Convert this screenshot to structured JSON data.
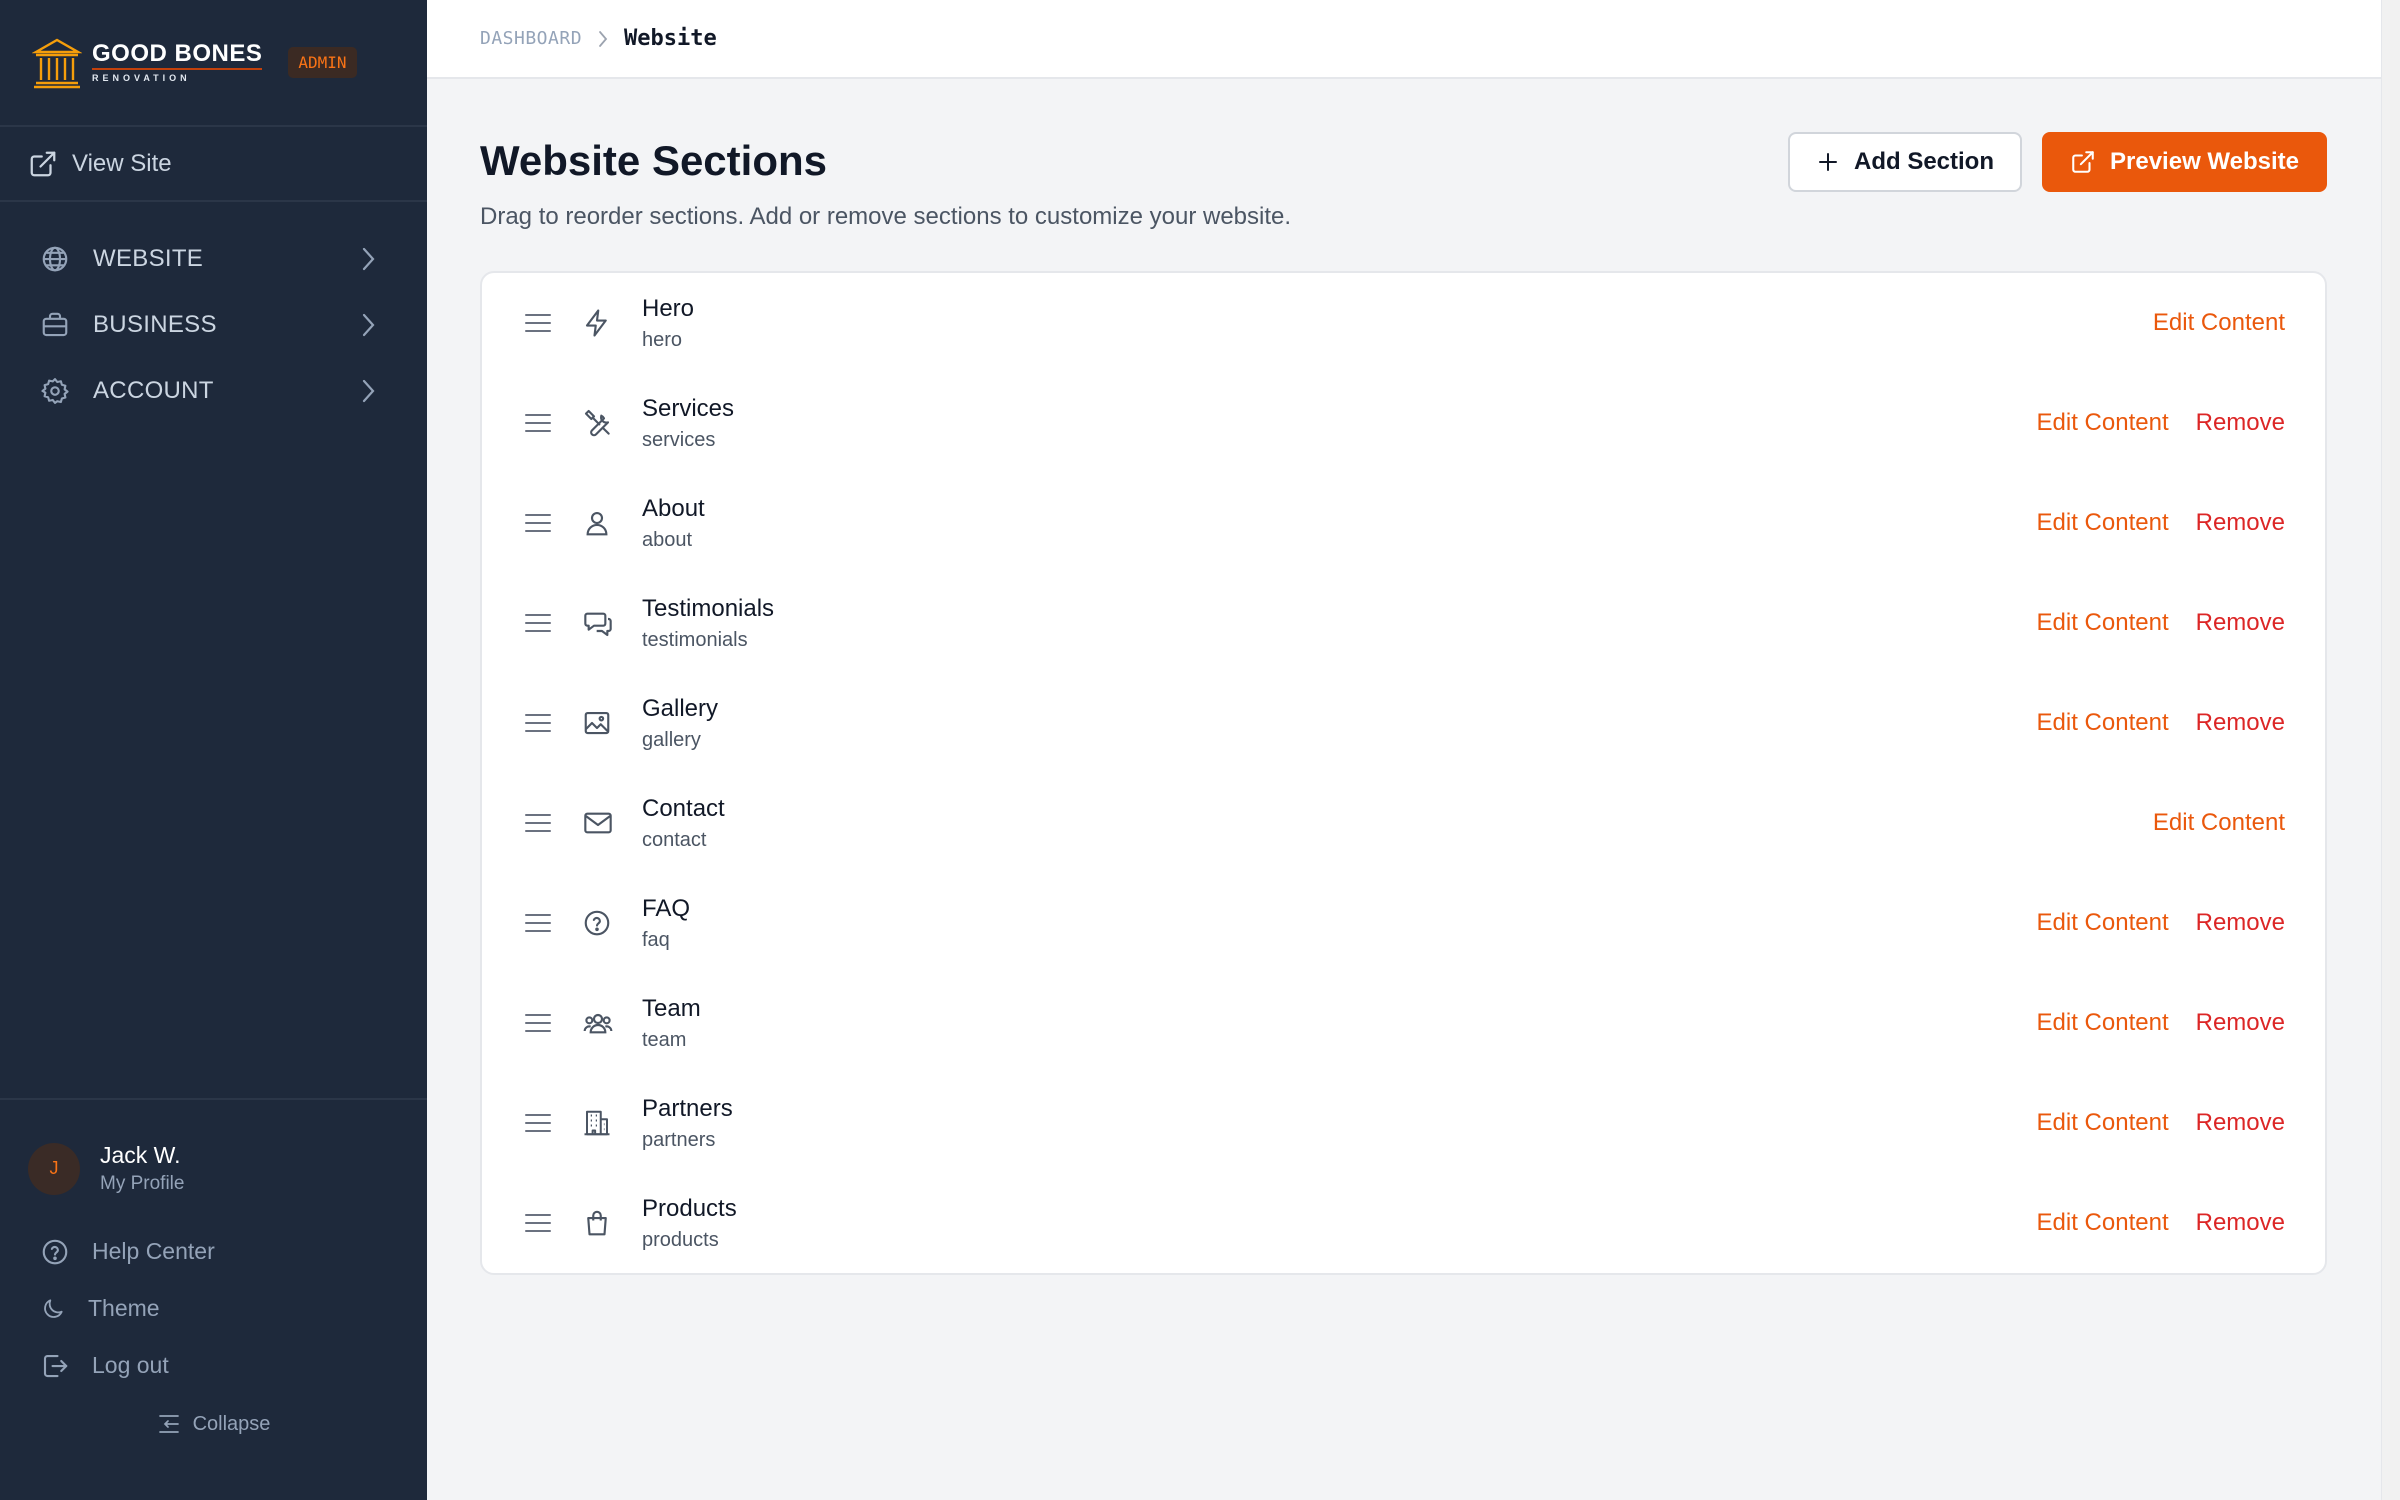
{
  "brand": {
    "name": "GOOD BONES",
    "sub": "RENOVATION",
    "badge": "ADMIN"
  },
  "sidebar": {
    "view_site": "View Site",
    "nav": [
      {
        "label": "WEBSITE",
        "icon": "globe-icon"
      },
      {
        "label": "BUSINESS",
        "icon": "briefcase-icon"
      },
      {
        "label": "ACCOUNT",
        "icon": "gear-icon"
      }
    ],
    "profile": {
      "initial": "J",
      "name": "Jack W.",
      "sub": "My Profile"
    },
    "help": "Help Center",
    "theme": "Theme",
    "logout": "Log out",
    "collapse": "Collapse"
  },
  "breadcrumb": {
    "root": "DASHBOARD",
    "current": "Website"
  },
  "page": {
    "title": "Website Sections",
    "description": "Drag to reorder sections. Add or remove sections to customize your website.",
    "add_button": "Add Section",
    "preview_button": "Preview Website"
  },
  "labels": {
    "edit": "Edit Content",
    "remove": "Remove"
  },
  "sections": [
    {
      "title": "Hero",
      "key": "hero",
      "icon": "lightning-icon",
      "removable": false
    },
    {
      "title": "Services",
      "key": "services",
      "icon": "tools-icon",
      "removable": true
    },
    {
      "title": "About",
      "key": "about",
      "icon": "user-icon",
      "removable": true
    },
    {
      "title": "Testimonials",
      "key": "testimonials",
      "icon": "chat-bubbles-icon",
      "removable": true
    },
    {
      "title": "Gallery",
      "key": "gallery",
      "icon": "image-icon",
      "removable": true
    },
    {
      "title": "Contact",
      "key": "contact",
      "icon": "envelope-icon",
      "removable": false
    },
    {
      "title": "FAQ",
      "key": "faq",
      "icon": "question-circle-icon",
      "removable": true
    },
    {
      "title": "Team",
      "key": "team",
      "icon": "users-icon",
      "removable": true
    },
    {
      "title": "Partners",
      "key": "partners",
      "icon": "building-icon",
      "removable": true
    },
    {
      "title": "Products",
      "key": "products",
      "icon": "shopping-bag-icon",
      "removable": true
    }
  ],
  "colors": {
    "sidebar_bg": "#1e293b",
    "accent": "#ea580c",
    "danger": "#dc2626"
  }
}
